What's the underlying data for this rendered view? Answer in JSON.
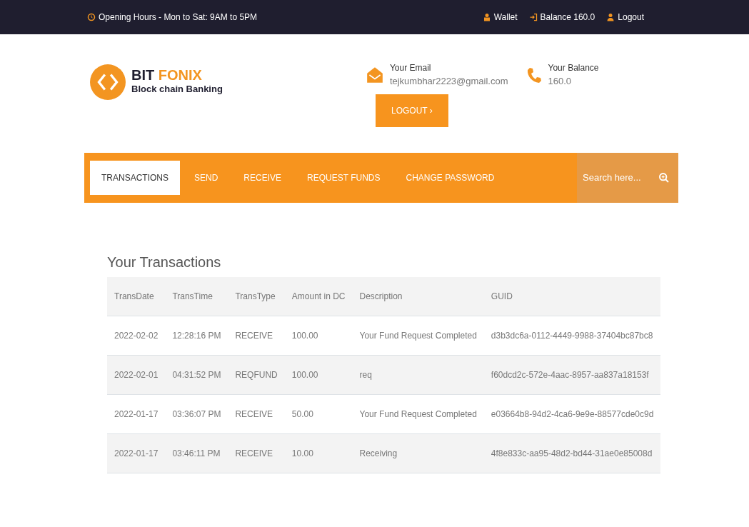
{
  "top_bar": {
    "hours": "Opening Hours - Mon to Sat: 9AM to 5PM",
    "links": [
      {
        "kind": "wallet",
        "label": "Wallet"
      },
      {
        "kind": "balance",
        "label": "Balance 160.0"
      },
      {
        "kind": "logout",
        "label": "Logout"
      }
    ]
  },
  "logo": {
    "name_first": "BIT",
    "name_second": "FONIX",
    "tagline": "Block chain Banking"
  },
  "info": [
    {
      "kind": "email",
      "label": "Your Email",
      "value": "tejkumbhar2223@gmail.com"
    },
    {
      "kind": "balance",
      "label": "Your Balance",
      "value": "160.0"
    }
  ],
  "logout_button": "LOGOUT ›",
  "nav": [
    {
      "label": "TRANSACTIONS",
      "selected": true
    },
    {
      "label": "SEND",
      "selected": false
    },
    {
      "label": "RECEIVE",
      "selected": false
    },
    {
      "label": "REQUEST FUNDS",
      "selected": false
    },
    {
      "label": "CHANGE PASSWORD",
      "selected": false
    }
  ],
  "search": {
    "placeholder": "Search here..."
  },
  "section_title": "Your Transactions",
  "table": {
    "columns": [
      "TransDate",
      "TransTime",
      "TransType",
      "Amount in DC",
      "Description",
      "GUID"
    ],
    "rows": [
      [
        "2022-02-02",
        "12:28:16 PM",
        "RECEIVE",
        "100.00",
        "Your Fund Request Completed",
        "d3b3dc6a-0112-4449-9988-37404bc87bc8"
      ],
      [
        "2022-02-01",
        "04:31:52 PM",
        "REQFUND",
        "100.00",
        "req",
        "f60dcd2c-572e-4aac-8957-aa837a18153f"
      ],
      [
        "2022-01-17",
        "03:36:07 PM",
        "RECEIVE",
        "50.00",
        "Your Fund Request Completed",
        "e03664b8-94d2-4ca6-9e9e-88577cde0c9d"
      ],
      [
        "2022-01-17",
        "03:46:11 PM",
        "RECEIVE",
        "10.00",
        "Receiving",
        "4f8e833c-aa95-48d2-bd44-31ae0e85008d"
      ]
    ]
  }
}
